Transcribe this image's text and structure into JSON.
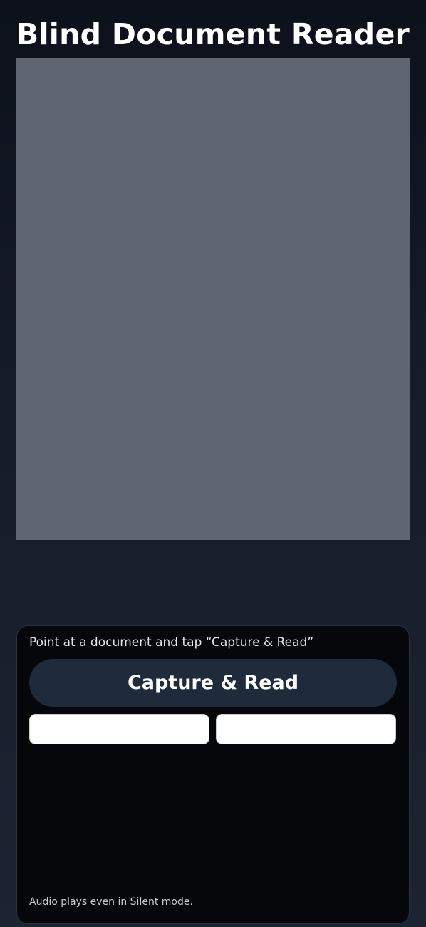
{
  "app": {
    "title": "Blind Document Reader"
  },
  "panel": {
    "hint": "Point at a document and tap “Capture & Read”",
    "capture_label": "Capture & Read",
    "secondary_left_label": "",
    "secondary_right_label": "",
    "footnote": "Audio plays even in Silent mode."
  },
  "colors": {
    "background": "#0c111b",
    "camera_preview": "#5f6571",
    "panel": "#05070b",
    "capture_button": "#1f2a3a"
  }
}
